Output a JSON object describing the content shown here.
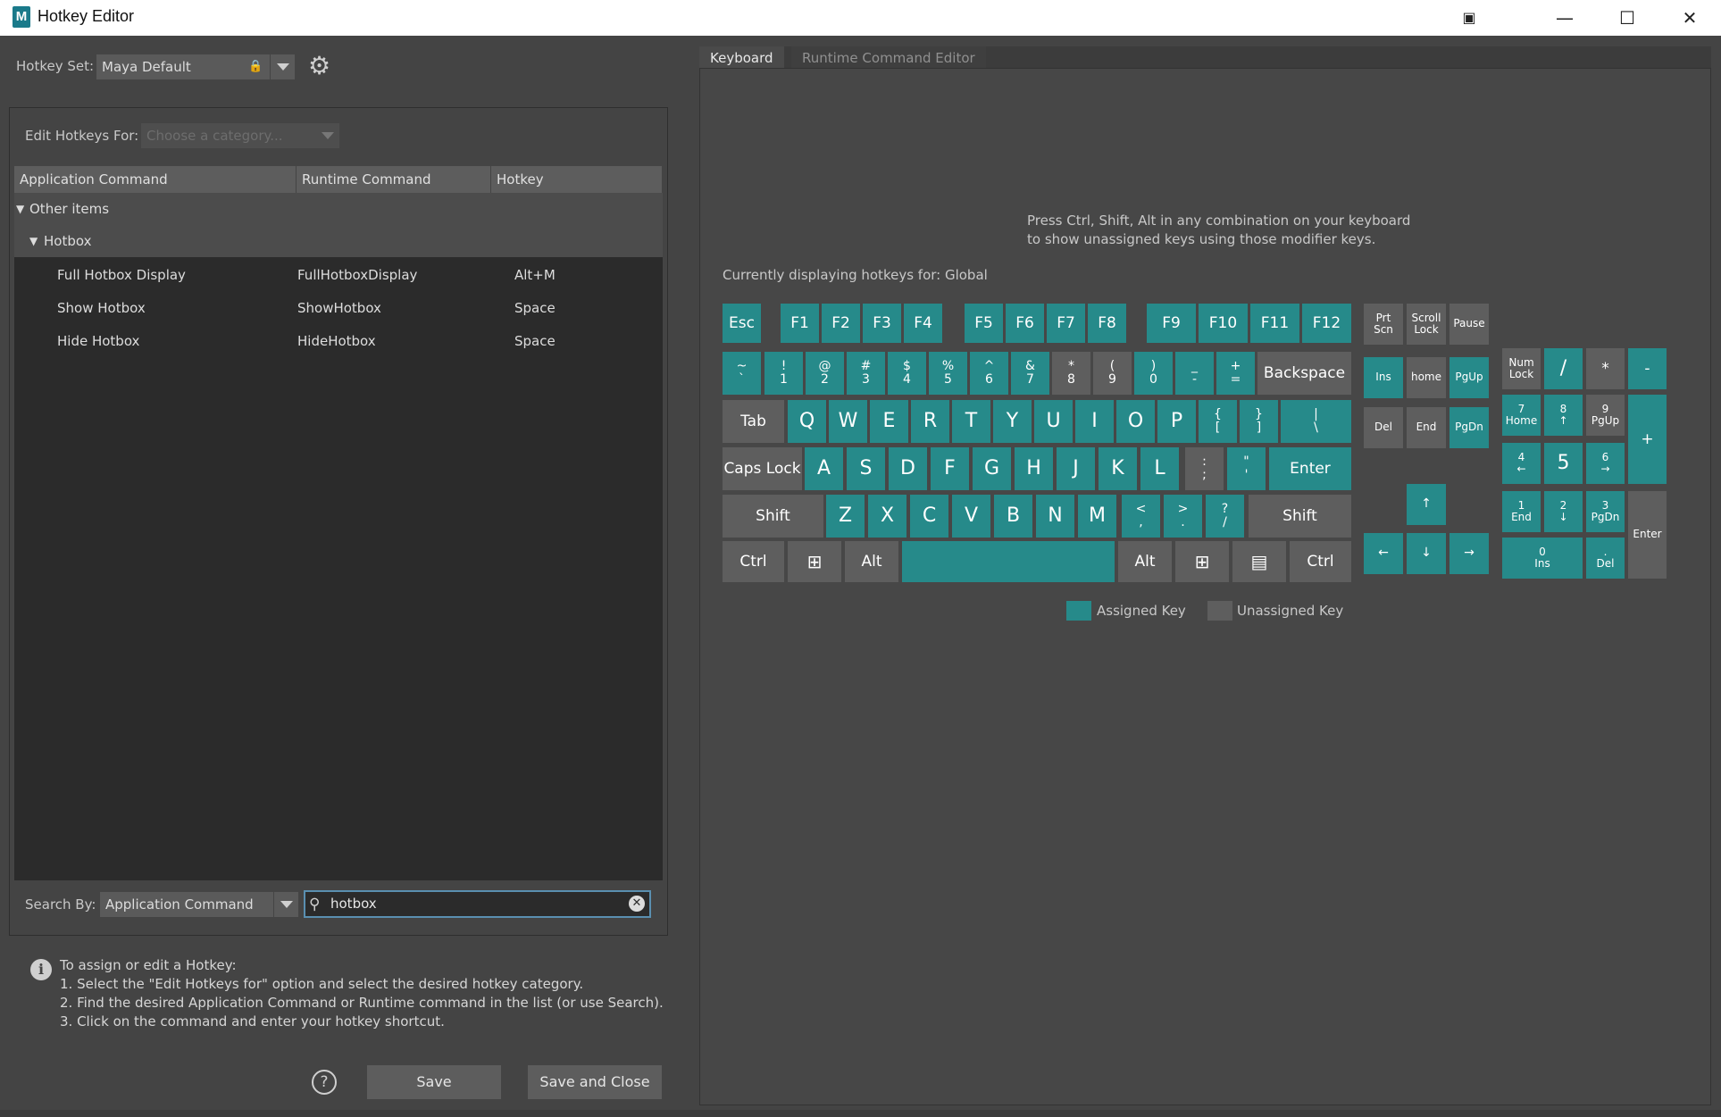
{
  "window": {
    "title": "Hotkey Editor",
    "logo": "M"
  },
  "hotkey_set": {
    "label": "Hotkey Set:",
    "value": "Maya Default"
  },
  "edit_for": {
    "label": "Edit Hotkeys For:",
    "placeholder": "Choose a category..."
  },
  "table": {
    "headers": [
      "Application Command",
      "Runtime Command",
      "Hotkey"
    ],
    "groups": [
      "Other items",
      "Hotbox"
    ],
    "rows": [
      {
        "app": "Full Hotbox Display",
        "runtime": "FullHotboxDisplay",
        "hotkey": "Alt+M"
      },
      {
        "app": "Show Hotbox",
        "runtime": "ShowHotbox",
        "hotkey": "Space"
      },
      {
        "app": "Hide Hotbox",
        "runtime": "HideHotbox",
        "hotkey": "Space"
      }
    ]
  },
  "search": {
    "label": "Search By:",
    "by_value": "Application Command",
    "query": "hotbox"
  },
  "info": {
    "lines": [
      "To assign or edit a Hotkey:",
      "1. Select the \"Edit Hotkeys for\" option and select the desired hotkey category.",
      "2. Find the desired Application Command or Runtime command in the list (or use Search).",
      "3. Click on the command and enter your hotkey shortcut."
    ]
  },
  "buttons": {
    "save": "Save",
    "save_close": "Save and Close",
    "help": "?"
  },
  "tabs": [
    "Keyboard",
    "Runtime Command Editor"
  ],
  "keyboard": {
    "instruction_1": "Press Ctrl, Shift, Alt in any combination on your keyboard",
    "instruction_2": "to show unassigned keys using those modifier keys.",
    "displaying": "Currently displaying hotkeys for: Global",
    "legend_assigned": "Assigned Key",
    "legend_unassigned": "Unassigned Key",
    "colors": {
      "assigned": "#268a8a",
      "unassigned": "#5e5e5e"
    },
    "keys": {
      "esc": "Esc",
      "f": [
        "F1",
        "F2",
        "F3",
        "F4",
        "F5",
        "F6",
        "F7",
        "F8",
        "F9",
        "F10",
        "F11",
        "F12"
      ],
      "prtscn": [
        "Prt",
        "Scn"
      ],
      "scrolllock": [
        "Scroll",
        "Lock"
      ],
      "pause": "Pause",
      "numrow": [
        [
          "~",
          "`"
        ],
        [
          "!",
          "1"
        ],
        [
          "@",
          "2"
        ],
        [
          "#",
          "3"
        ],
        [
          "$",
          "4"
        ],
        [
          "%",
          "5"
        ],
        [
          "^",
          "6"
        ],
        [
          "&",
          "7"
        ],
        [
          "*",
          "8"
        ],
        [
          "(",
          "9"
        ],
        [
          ")",
          "0"
        ],
        [
          "_",
          "-"
        ],
        [
          "+",
          "="
        ]
      ],
      "backspace": "Backspace",
      "tab": "Tab",
      "qrow": [
        "Q",
        "W",
        "E",
        "R",
        "T",
        "Y",
        "U",
        "I",
        "O",
        "P"
      ],
      "qrow_sym": [
        [
          "{",
          "["
        ],
        [
          "}",
          "]"
        ],
        [
          "|",
          "\\"
        ]
      ],
      "capslock": "Caps Lock",
      "arow": [
        "A",
        "S",
        "D",
        "F",
        "G",
        "H",
        "J",
        "K",
        "L"
      ],
      "arow_sym": [
        [
          ":",
          ";"
        ],
        [
          "\"",
          "'"
        ]
      ],
      "enter": "Enter",
      "shift": "Shift",
      "zrow": [
        "Z",
        "X",
        "C",
        "V",
        "B",
        "N",
        "M"
      ],
      "zrow_sym": [
        [
          "<",
          ","
        ],
        [
          ">",
          "."
        ],
        [
          "?",
          "/"
        ]
      ],
      "ctrl": "Ctrl",
      "alt": "Alt",
      "ins": "Ins",
      "home": "home",
      "pgup": "PgUp",
      "del": "Del",
      "end": "End",
      "pgdn": "PgDn",
      "arrows": [
        "↑",
        "←",
        "↓",
        "→"
      ],
      "numlock": [
        "Num",
        "Lock"
      ],
      "np_div": "/",
      "np_mul": "*",
      "np_minus": "-",
      "np_plus": "+",
      "np7": [
        "7",
        "Home"
      ],
      "np8": [
        "8",
        "↑"
      ],
      "np9": [
        "9",
        "PgUp"
      ],
      "np4": [
        "4",
        "←"
      ],
      "np5": "5",
      "np6": [
        "6",
        "→"
      ],
      "np1": [
        "1",
        "End"
      ],
      "np2": [
        "2",
        "↓"
      ],
      "np3": [
        "3",
        "PgDn"
      ],
      "np0": [
        "0",
        "Ins"
      ],
      "npdot": [
        ".",
        "Del"
      ],
      "np_enter": "Enter"
    }
  }
}
